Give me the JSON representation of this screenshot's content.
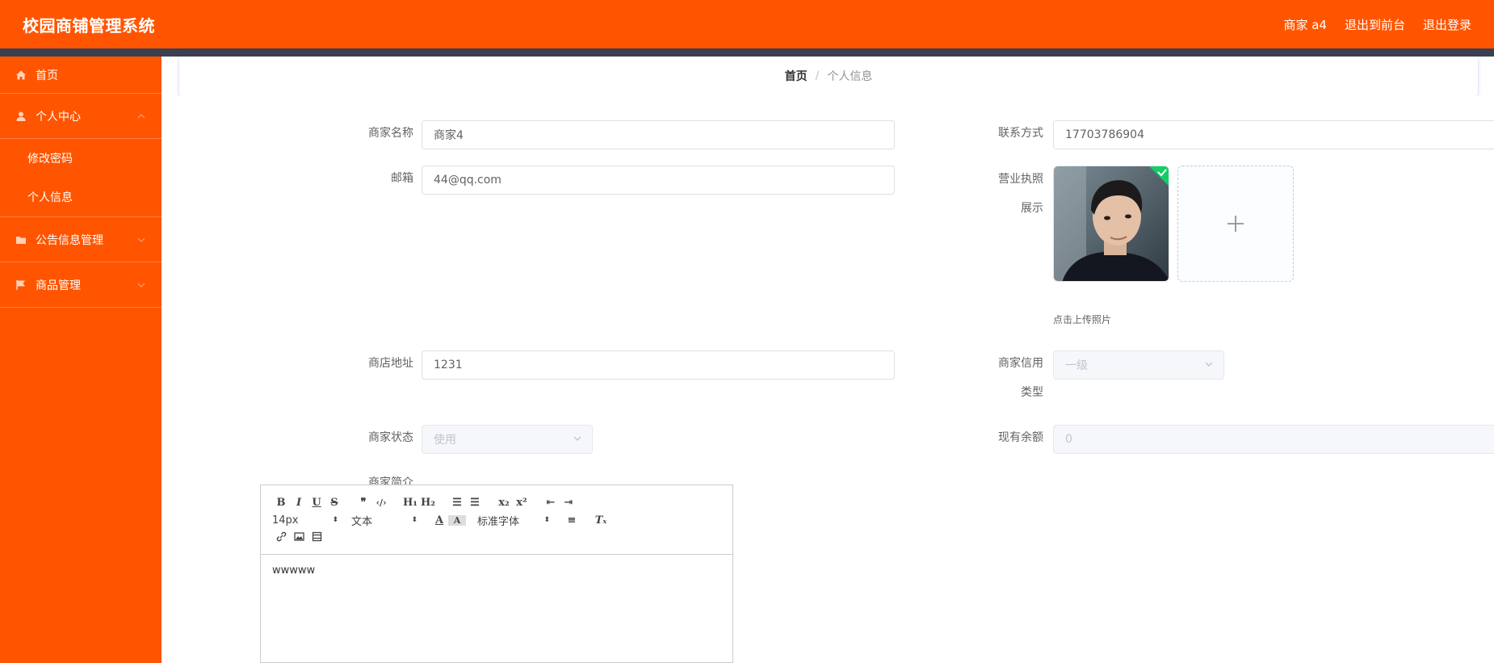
{
  "header": {
    "title": "校园商铺管理系统",
    "user": "商家 a4",
    "back_front": "退出到前台",
    "logout": "退出登录"
  },
  "sidebar": {
    "home": "首页",
    "personal_center": "个人中心",
    "change_password": "修改密码",
    "personal_info": "个人信息",
    "announcement": "公告信息管理",
    "goods": "商品管理"
  },
  "breadcrumb": {
    "home": "首页",
    "separator": "/",
    "current": "个人信息"
  },
  "form": {
    "shop_name_label": "商家名称",
    "shop_name_value": "商家4",
    "contact_label": "联系方式",
    "contact_value": "17703786904",
    "email_label": "邮箱",
    "email_value": "44@qq.com",
    "license_label_1": "营业执照",
    "license_label_2": "展示",
    "upload_tip": "点击上传照片",
    "address_label": "商店地址",
    "address_value": "1231",
    "credit_label_1": "商家信用",
    "credit_label_2": "类型",
    "credit_value": "一级",
    "status_label": "商家状态",
    "status_value": "使用",
    "balance_label": "现有余额",
    "balance_value": "0",
    "intro_label": "商家简介"
  },
  "editor": {
    "font_size": "14px",
    "paragraph": "文本",
    "font_family": "标准字体",
    "content": "wwwww"
  },
  "colors": {
    "brand": "#ff5500",
    "strip": "#3a3f51",
    "check": "#13ce66"
  }
}
